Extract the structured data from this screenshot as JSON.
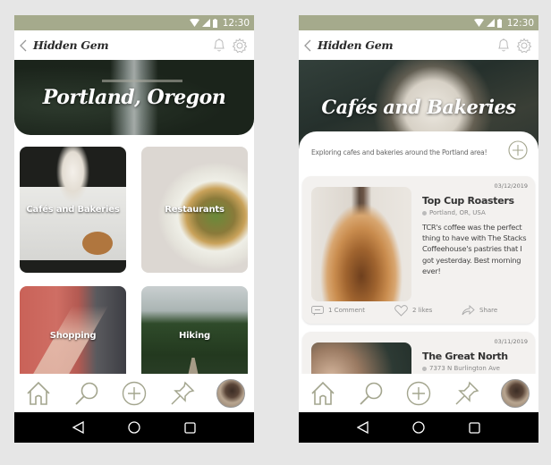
{
  "status_bar": {
    "time": "12:30"
  },
  "app": {
    "title": "Hidden Gem"
  },
  "left_screen": {
    "hero_title": "Portland, Oregon",
    "categories": [
      {
        "label": "Cafés and Bakeries"
      },
      {
        "label": "Restaurants"
      },
      {
        "label": "Shopping"
      },
      {
        "label": "Hiking"
      }
    ]
  },
  "right_screen": {
    "hero_title": "Cafés and Bakeries",
    "intro": "Exploring cafes and bakeries around the Portland area!",
    "posts": [
      {
        "date": "03/12/2019",
        "name": "Top Cup Roasters",
        "location": "Portland, OR, USA",
        "body": "TCR's coffee was the perfect thing to have with The Stacks Coffeehouse's pastries that I got yesterday. Best morning ever!",
        "comments": "1 Comment",
        "likes": "2 likes",
        "share": "Share"
      },
      {
        "date": "03/11/2019",
        "name": "The Great North",
        "location": "7373 N Burlington Ave"
      }
    ]
  },
  "bottom_nav": [
    "home",
    "search",
    "add",
    "pin",
    "profile"
  ],
  "colors": {
    "status_bar": "#a5aa8c",
    "icon": "#a3a58e",
    "card_bg": "#f3f1ef"
  }
}
